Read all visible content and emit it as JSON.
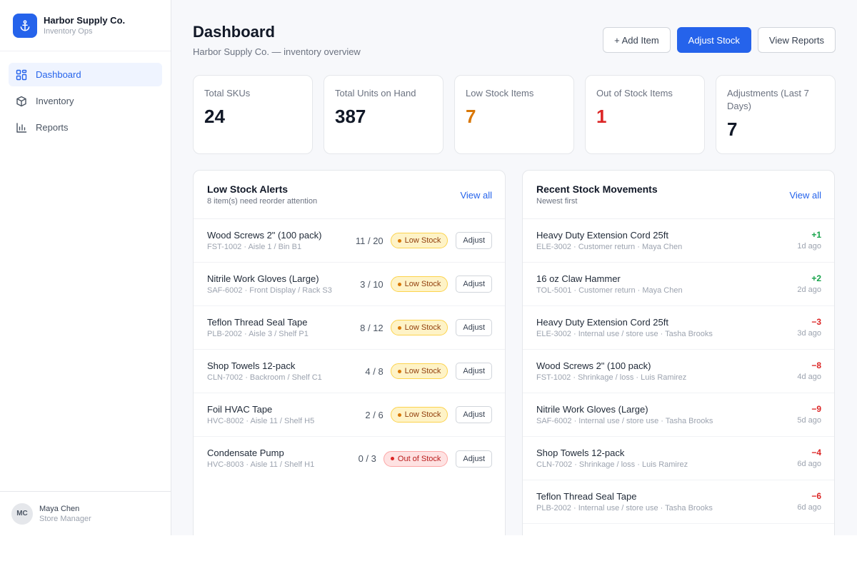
{
  "brand": {
    "name": "Harbor Supply Co.",
    "subtitle": "Inventory Ops"
  },
  "nav": [
    {
      "label": "Dashboard",
      "icon": "grid-icon",
      "active": true
    },
    {
      "label": "Inventory",
      "icon": "box-icon",
      "active": false
    },
    {
      "label": "Reports",
      "icon": "bar-chart-icon",
      "active": false
    }
  ],
  "user": {
    "initials": "MC",
    "name": "Maya Chen",
    "role": "Store Manager"
  },
  "header": {
    "title": "Dashboard",
    "subtitle": "Harbor Supply Co. — inventory overview",
    "add_item": "+ Add Item",
    "adjust_stock": "Adjust Stock",
    "view_reports": "View Reports"
  },
  "stats": [
    {
      "label": "Total SKUs",
      "value": "24",
      "color": "#111827"
    },
    {
      "label": "Total Units on Hand",
      "value": "387",
      "color": "#111827"
    },
    {
      "label": "Low Stock Items",
      "value": "7",
      "color": "#d97706"
    },
    {
      "label": "Out of Stock Items",
      "value": "1",
      "color": "#dc2626"
    },
    {
      "label": "Adjustments (Last 7 Days)",
      "value": "7",
      "color": "#111827"
    }
  ],
  "low_stock": {
    "title": "Low Stock Alerts",
    "subtitle": "8 item(s) need reorder attention",
    "view_all": "View all",
    "adjust_label": "Adjust",
    "items": [
      {
        "name": "Wood Screws 2\" (100 pack)",
        "meta": "FST-1002 · Aisle 1 / Bin B1",
        "qty": "11 / 20",
        "status": "Low Stock",
        "kind": "low"
      },
      {
        "name": "Nitrile Work Gloves (Large)",
        "meta": "SAF-6002 · Front Display / Rack S3",
        "qty": "3 / 10",
        "status": "Low Stock",
        "kind": "low"
      },
      {
        "name": "Teflon Thread Seal Tape",
        "meta": "PLB-2002 · Aisle 3 / Shelf P1",
        "qty": "8 / 12",
        "status": "Low Stock",
        "kind": "low"
      },
      {
        "name": "Shop Towels 12-pack",
        "meta": "CLN-7002 · Backroom / Shelf C1",
        "qty": "4 / 8",
        "status": "Low Stock",
        "kind": "low"
      },
      {
        "name": "Foil HVAC Tape",
        "meta": "HVC-8002 · Aisle 11 / Shelf H5",
        "qty": "2 / 6",
        "status": "Low Stock",
        "kind": "low"
      },
      {
        "name": "Condensate Pump",
        "meta": "HVC-8003 · Aisle 11 / Shelf H1",
        "qty": "0 / 3",
        "status": "Out of Stock",
        "kind": "out"
      }
    ]
  },
  "movements": {
    "title": "Recent Stock Movements",
    "subtitle": "Newest first",
    "view_all": "View all",
    "items": [
      {
        "name": "Heavy Duty Extension Cord 25ft",
        "meta": "ELE-3002 · Customer return · Maya Chen",
        "delta": "+1",
        "ago": "1d ago"
      },
      {
        "name": "16 oz Claw Hammer",
        "meta": "TOL-5001 · Customer return · Maya Chen",
        "delta": "+2",
        "ago": "2d ago"
      },
      {
        "name": "Heavy Duty Extension Cord 25ft",
        "meta": "ELE-3002 · Internal use / store use · Tasha Brooks",
        "delta": "−3",
        "ago": "3d ago"
      },
      {
        "name": "Wood Screws 2\" (100 pack)",
        "meta": "FST-1002 · Shrinkage / loss · Luis Ramirez",
        "delta": "−8",
        "ago": "4d ago"
      },
      {
        "name": "Nitrile Work Gloves (Large)",
        "meta": "SAF-6002 · Internal use / store use · Tasha Brooks",
        "delta": "−9",
        "ago": "5d ago"
      },
      {
        "name": "Shop Towels 12-pack",
        "meta": "CLN-7002 · Shrinkage / loss · Luis Ramirez",
        "delta": "−4",
        "ago": "6d ago"
      },
      {
        "name": "Teflon Thread Seal Tape",
        "meta": "PLB-2002 · Internal use / store use · Tasha Brooks",
        "delta": "−6",
        "ago": "6d ago"
      }
    ]
  }
}
